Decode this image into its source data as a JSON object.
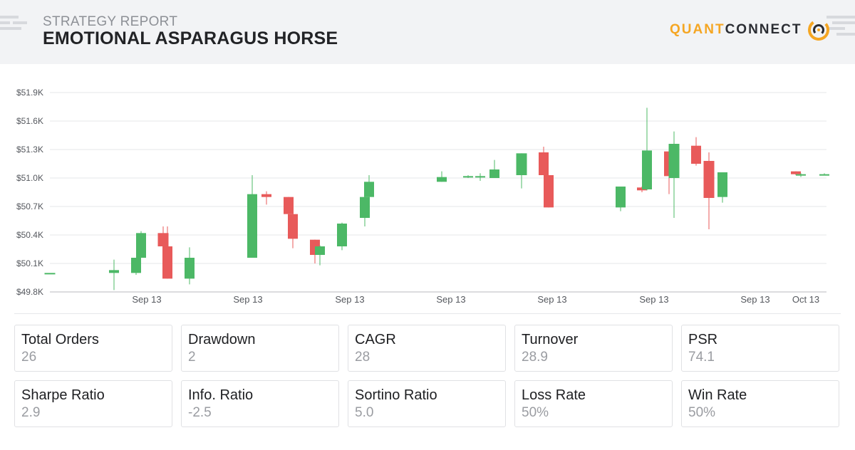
{
  "header": {
    "subtitle": "STRATEGY REPORT",
    "title": "EMOTIONAL ASPARAGUS HORSE",
    "logo_part1": "QUANT",
    "logo_part2": "CONNECT"
  },
  "colors": {
    "up": "#4cb866",
    "down": "#e85a5a",
    "grid": "#e6e7ea",
    "axis_text": "#55585e",
    "brand_orange": "#f5a623"
  },
  "chart_data": {
    "type": "candlestick",
    "title": "",
    "xlabel": "",
    "ylabel": "",
    "ylim": [
      49800,
      51900
    ],
    "y_ticks": [
      "$49.8K",
      "$50.1K",
      "$50.4K",
      "$50.7K",
      "$51.0K",
      "$51.3K",
      "$51.6K",
      "$51.9K"
    ],
    "x_ticks": [
      "Sep 13",
      "Sep 13",
      "Sep 13",
      "Sep 13",
      "Sep 13",
      "Sep 13",
      "Sep 13",
      "Oct 13"
    ],
    "grid": true,
    "candles": [
      {
        "open": 50000,
        "close": 50000,
        "high": 50000,
        "low": 50000
      },
      {
        "open": 50000,
        "close": 50030,
        "high": 50140,
        "low": 49820
      },
      {
        "open": 50000,
        "close": 50160,
        "high": 50160,
        "low": 49980
      },
      {
        "open": 50160,
        "close": 50420,
        "high": 50440,
        "low": 50160
      },
      {
        "open": 50420,
        "close": 50280,
        "high": 50490,
        "low": 50280
      },
      {
        "open": 50280,
        "close": 49940,
        "high": 50490,
        "low": 49940
      },
      {
        "open": 49940,
        "close": 50160,
        "high": 50270,
        "low": 49880
      },
      {
        "open": 50160,
        "close": 50830,
        "high": 51030,
        "low": 50160
      },
      {
        "open": 50830,
        "close": 50800,
        "high": 50860,
        "low": 50720
      },
      {
        "open": 50800,
        "close": 50620,
        "high": 50800,
        "low": 50620
      },
      {
        "open": 50620,
        "close": 50360,
        "high": 50620,
        "low": 50260
      },
      {
        "open": 50350,
        "close": 50190,
        "high": 50350,
        "low": 50100
      },
      {
        "open": 50190,
        "close": 50280,
        "high": 50290,
        "low": 50080
      },
      {
        "open": 50280,
        "close": 50520,
        "high": 50530,
        "low": 50240
      },
      {
        "open": 50580,
        "close": 50800,
        "high": 50800,
        "low": 50490
      },
      {
        "open": 50800,
        "close": 50960,
        "high": 51030,
        "low": 50800
      },
      {
        "open": 50960,
        "close": 51010,
        "high": 51070,
        "low": 50960
      },
      {
        "open": 51010,
        "close": 51020,
        "high": 51030,
        "low": 51000
      },
      {
        "open": 51020,
        "close": 51020,
        "high": 51050,
        "low": 50970
      },
      {
        "open": 51000,
        "close": 51090,
        "high": 51190,
        "low": 51000
      },
      {
        "open": 51030,
        "close": 51260,
        "high": 51260,
        "low": 50890
      },
      {
        "open": 51270,
        "close": 51030,
        "high": 51330,
        "low": 51030
      },
      {
        "open": 51030,
        "close": 50690,
        "high": 51030,
        "low": 50690
      },
      {
        "open": 50690,
        "close": 50910,
        "high": 50910,
        "low": 50650
      },
      {
        "open": 50900,
        "close": 50870,
        "high": 50910,
        "low": 50850
      },
      {
        "open": 50880,
        "close": 51290,
        "high": 51740,
        "low": 50870
      },
      {
        "open": 51280,
        "close": 51020,
        "high": 51280,
        "low": 50830
      },
      {
        "open": 51000,
        "close": 51360,
        "high": 51490,
        "low": 50580
      },
      {
        "open": 51340,
        "close": 51150,
        "high": 51430,
        "low": 51130
      },
      {
        "open": 51180,
        "close": 50790,
        "high": 51270,
        "low": 50460
      },
      {
        "open": 50800,
        "close": 51060,
        "high": 51060,
        "low": 50740
      },
      {
        "open": 51070,
        "close": 51040,
        "high": 51070,
        "low": 51030
      },
      {
        "open": 51040,
        "close": 51040,
        "high": 51050,
        "low": 51010
      },
      {
        "open": 51040,
        "close": 51040,
        "high": 51050,
        "low": 51030
      }
    ]
  },
  "stats": [
    {
      "label": "Total Orders",
      "value": "26"
    },
    {
      "label": "Drawdown",
      "value": "2"
    },
    {
      "label": "CAGR",
      "value": "28"
    },
    {
      "label": "Turnover",
      "value": "28.9"
    },
    {
      "label": "PSR",
      "value": "74.1"
    },
    {
      "label": "Sharpe Ratio",
      "value": "2.9"
    },
    {
      "label": "Info. Ratio",
      "value": "-2.5"
    },
    {
      "label": "Sortino Ratio",
      "value": "5.0"
    },
    {
      "label": "Loss Rate",
      "value": "50%"
    },
    {
      "label": "Win Rate",
      "value": "50%"
    }
  ]
}
